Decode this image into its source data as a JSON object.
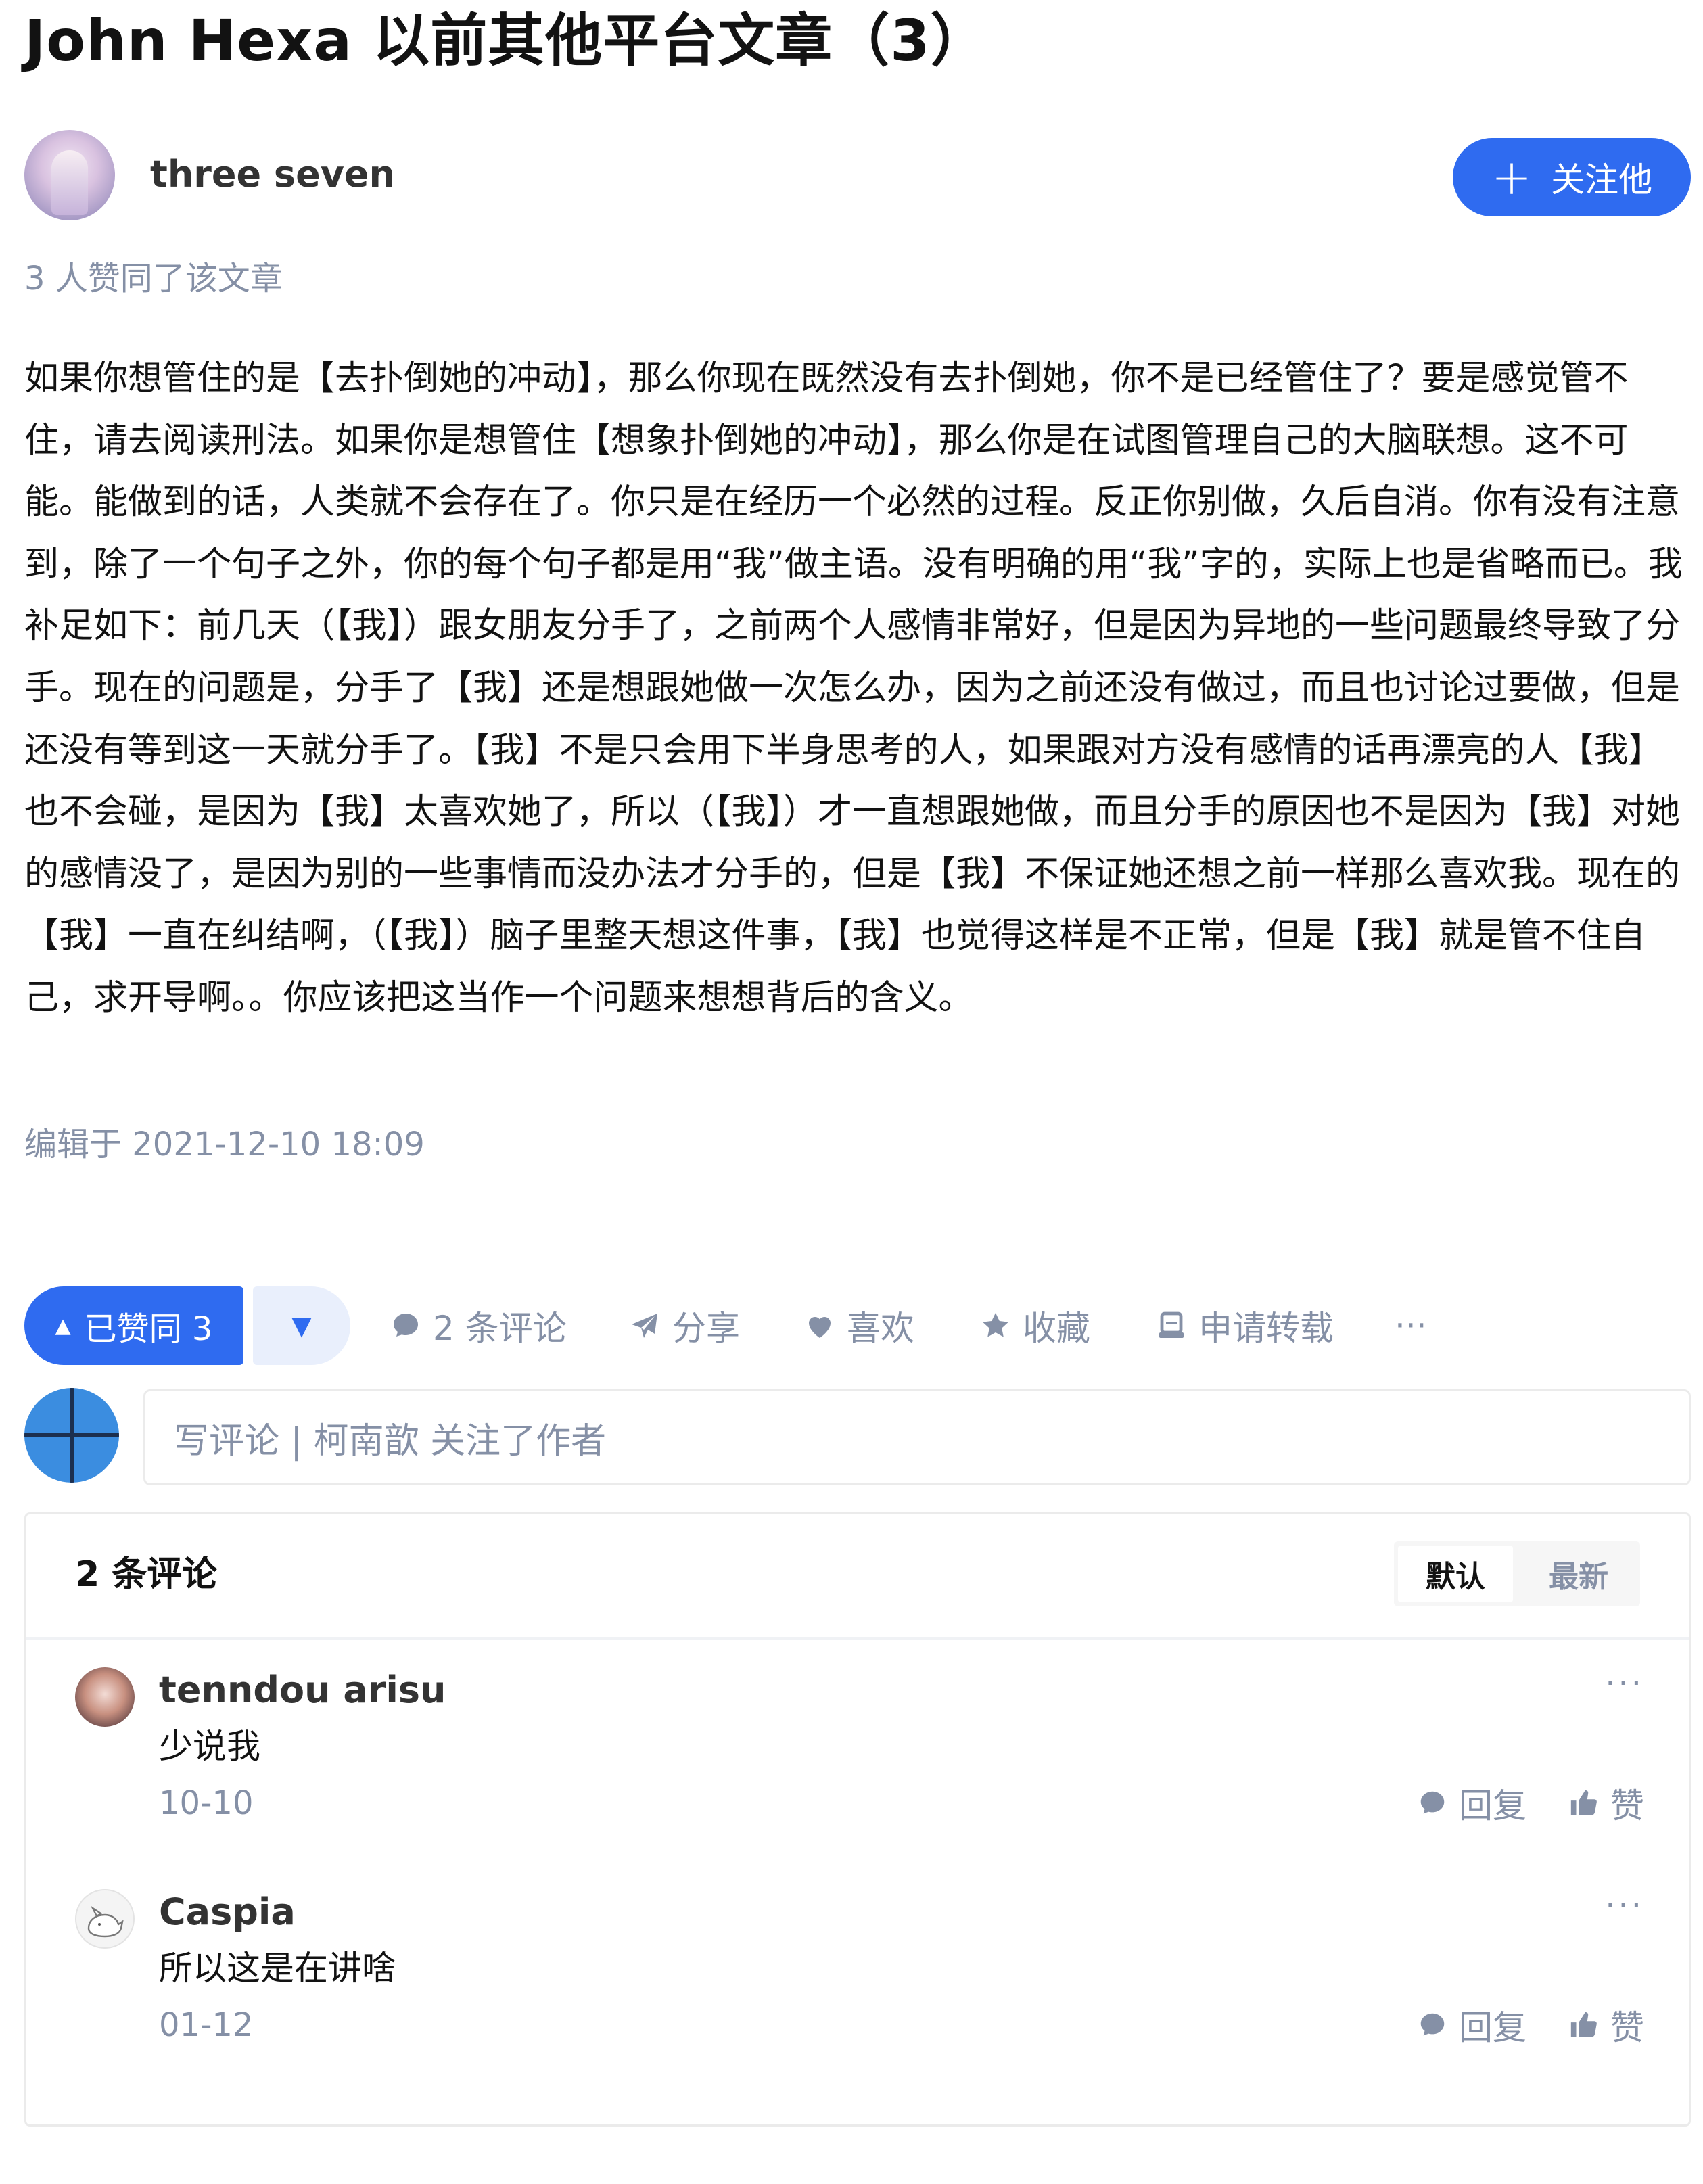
{
  "article": {
    "title": "John Hexa 以前其他平台文章（3）",
    "author_name": "three seven",
    "follow_label": "关注他",
    "likes_text": "3 人赞同了该文章",
    "content": "如果你想管住的是【去扑倒她的冲动】，那么你现在既然没有去扑倒她，你不是已经管住了？要是感觉管不住，请去阅读刑法。如果你是想管住【想象扑倒她的冲动】，那么你是在试图管理自己的大脑联想。这不可能。能做到的话，人类就不会存在了。你只是在经历一个必然的过程。反正你别做，久后自消。你有没有注意到，除了一个句子之外，你的每个句子都是用“我”做主语。没有明确的用“我”字的，实际上也是省略而已。我补足如下：前几天（【我】）跟女朋友分手了，之前两个人感情非常好，但是因为异地的一些问题最终导致了分手。现在的问题是，分手了【我】还是想跟她做一次怎么办，因为之前还没有做过，而且也讨论过要做，但是还没有等到这一天就分手了。【我】不是只会用下半身思考的人，如果跟对方没有感情的话再漂亮的人【我】也不会碰，是因为【我】太喜欢她了，所以（【我】）才一直想跟她做，而且分手的原因也不是因为【我】对她的感情没了，是因为别的一些事情而没办法才分手的，但是【我】不保证她还想之前一样那么喜欢我。现在的【我】一直在纠结啊，（【我】）脑子里整天想这件事，【我】也觉得这样是不正常，但是【我】就是管不住自己，求开导啊。。你应该把这当作一个问题来想想背后的含义。",
    "edited": "编辑于 2021-12-10 18:09"
  },
  "actions": {
    "voted_label": "已赞同 3",
    "comments": "2 条评论",
    "share": "分享",
    "like": "喜欢",
    "favorite": "收藏",
    "repost": "申请转载",
    "more": "···"
  },
  "comment_box": {
    "placeholder": "写评论 | 柯南歆 关注了作者"
  },
  "comments": {
    "title": "2 条评论",
    "sort_default": "默认",
    "sort_latest": "最新",
    "reply_label": "回复",
    "like_label": "赞",
    "items": [
      {
        "name": "tenndou arisu",
        "text": "少说我",
        "date": "10-10"
      },
      {
        "name": "Caspia",
        "text": "所以这是在讲啥",
        "date": "01-12"
      }
    ]
  },
  "colors": {
    "accent": "#2f6bf0",
    "muted": "#8590a6",
    "text": "#121212"
  }
}
